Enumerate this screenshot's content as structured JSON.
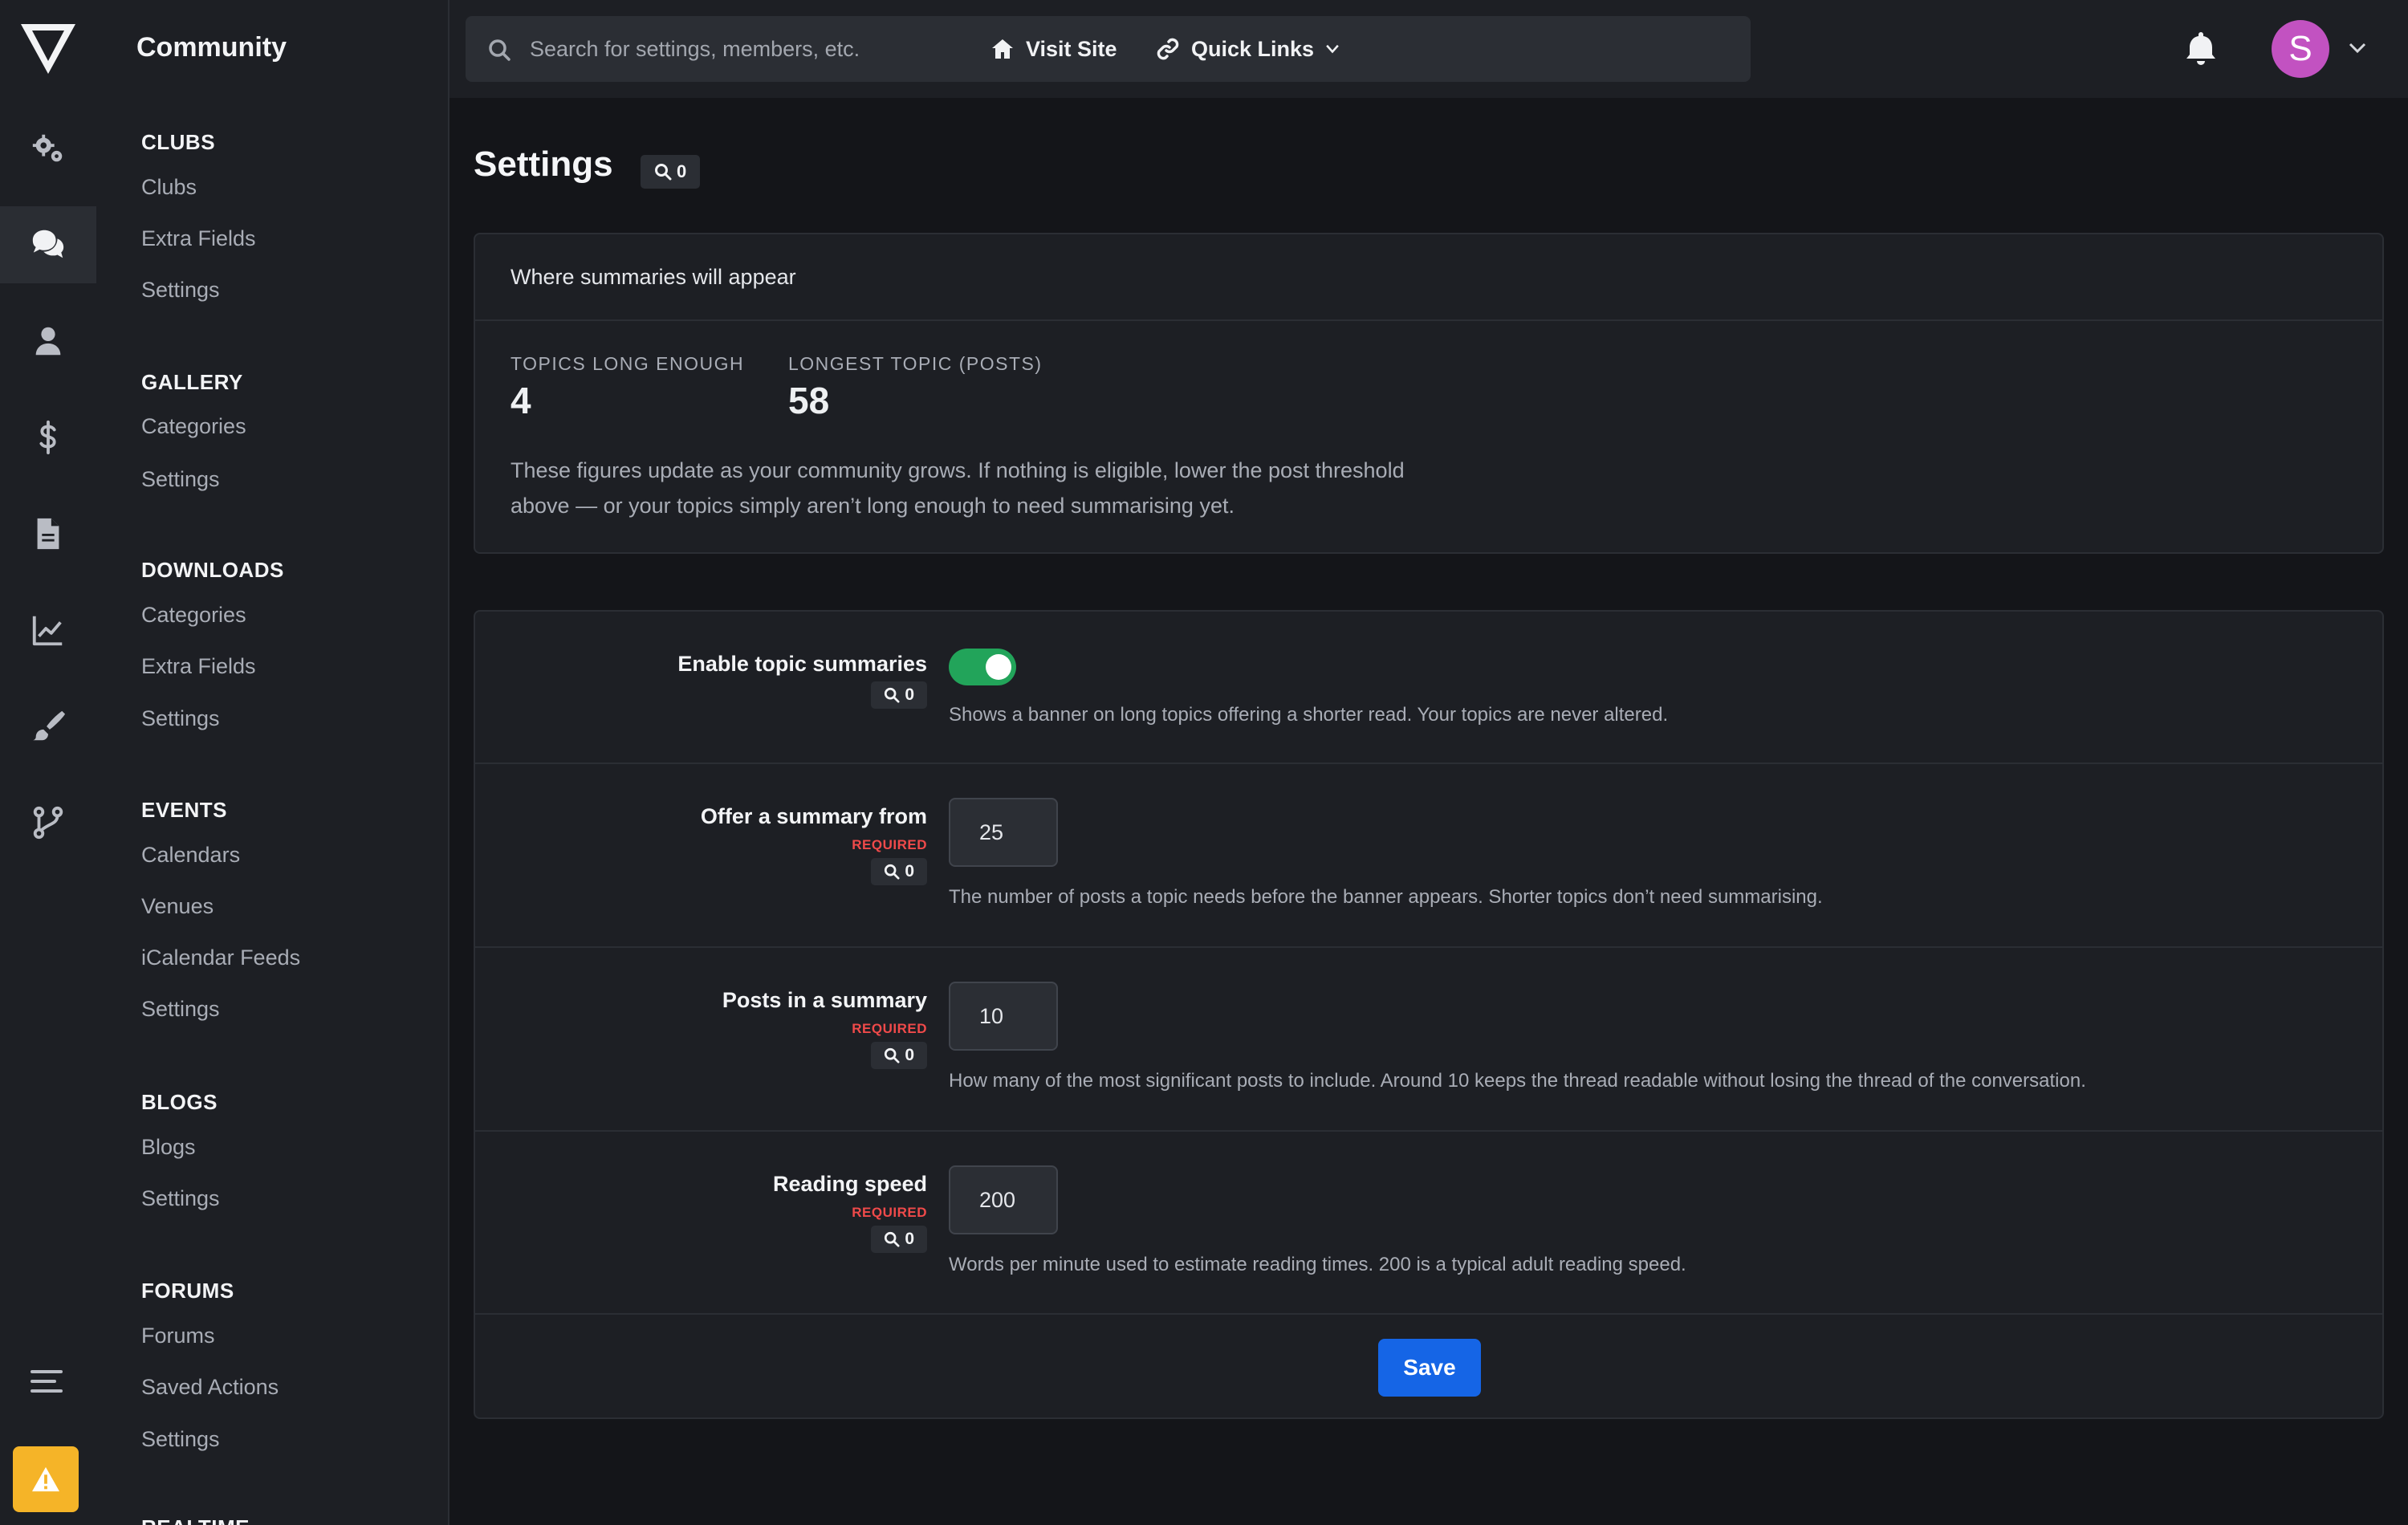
{
  "rail": {
    "items": [
      {
        "icon": "gears-icon"
      },
      {
        "icon": "comments-icon",
        "active": true
      },
      {
        "icon": "user-icon"
      },
      {
        "icon": "dollar-icon"
      },
      {
        "icon": "file-icon"
      },
      {
        "icon": "chart-line-icon"
      },
      {
        "icon": "paintbrush-icon"
      },
      {
        "icon": "code-branch-icon"
      }
    ]
  },
  "subnav": {
    "title": "Community",
    "groups": [
      {
        "title": "CLUBS",
        "links": [
          "Clubs",
          "Extra Fields",
          "Settings"
        ]
      },
      {
        "title": "GALLERY",
        "links": [
          "Categories",
          "Settings"
        ]
      },
      {
        "title": "DOWNLOADS",
        "links": [
          "Categories",
          "Extra Fields",
          "Settings"
        ]
      },
      {
        "title": "EVENTS",
        "links": [
          "Calendars",
          "Venues",
          "iCalendar Feeds",
          "Settings"
        ]
      },
      {
        "title": "BLOGS",
        "links": [
          "Blogs",
          "Settings"
        ]
      },
      {
        "title": "FORUMS",
        "links": [
          "Forums",
          "Saved Actions",
          "Settings"
        ]
      },
      {
        "title": "REALTIME",
        "links": []
      }
    ]
  },
  "topbar": {
    "search_placeholder": "Search for settings, members, etc.",
    "visit_site": "Visit Site",
    "quick_links": "Quick Links",
    "avatar_letter": "S",
    "avatar_color": "#c252c1"
  },
  "page": {
    "title": "Settings",
    "badge_count": "0"
  },
  "summary_card": {
    "heading": "Where summaries will appear",
    "stats": [
      {
        "label": "TOPICS LONG ENOUGH",
        "value": "4"
      },
      {
        "label": "LONGEST TOPIC (POSTS)",
        "value": "58"
      }
    ],
    "note": "These figures update as your community grows. If nothing is eligible, lower the post threshold above — or your topics simply aren’t long enough to need summarising yet."
  },
  "settings": {
    "required_label": "REQUIRED",
    "rows": [
      {
        "label": "Enable topic summaries",
        "badge": "0",
        "enabled": true,
        "desc": "Shows a banner on long topics offering a shorter read. Your topics are never altered."
      },
      {
        "label": "Offer a summary from",
        "badge": "0",
        "value": "25",
        "desc": "The number of posts a topic needs before the banner appears. Shorter topics don’t need summarising."
      },
      {
        "label": "Posts in a summary",
        "badge": "0",
        "value": "10",
        "desc": "How many of the most significant posts to include. Around 10 keeps the thread readable without losing the thread of the conversation."
      },
      {
        "label": "Reading speed",
        "badge": "0",
        "value": "200",
        "desc": "Words per minute used to estimate reading times. 200 is a typical adult reading speed."
      }
    ],
    "save_label": "Save"
  },
  "colors": {
    "accent": "#1565e6",
    "toggle_on": "#22a45a",
    "required": "#f04a4a",
    "alert": "#f5b428"
  }
}
